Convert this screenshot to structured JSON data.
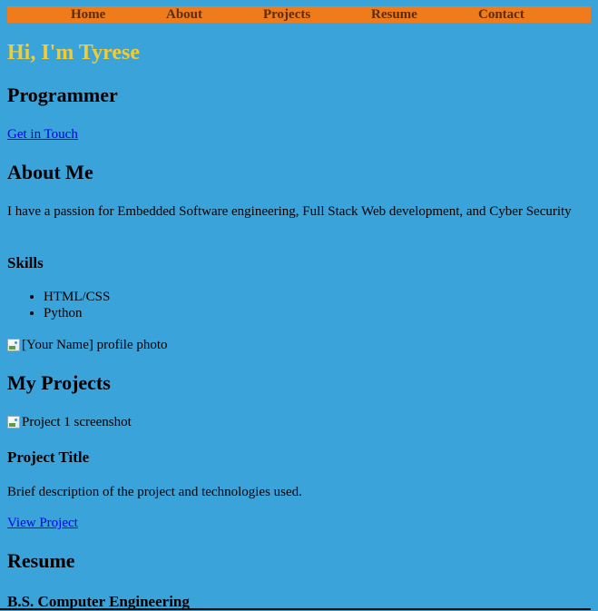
{
  "nav": {
    "items": [
      "Home",
      "About",
      "Projects",
      "Resume",
      "Contact"
    ]
  },
  "hero": {
    "title": "Hi, I'm Tyrese",
    "subtitle": "Programmer",
    "cta": "Get in Touch"
  },
  "about": {
    "title": "About Me",
    "text": "I have a passion for Embedded Software engineering, Full Stack Web development, and Cyber Security",
    "skills_title": "Skills",
    "skills": [
      "HTML/CSS",
      "Python"
    ],
    "photo_alt": "[Your Name] profile photo"
  },
  "projects": {
    "title": "My Projects",
    "screenshot_alt": "Project 1 screenshot",
    "project_title": "Project Title",
    "description": "Brief description of the project and technologies used.",
    "link": "View Project"
  },
  "resume": {
    "title": "Resume",
    "degree": "B.S. Computer Engineering"
  },
  "colors": {
    "page_background": "#3aa3da",
    "nav_background": "#ef7b1a",
    "hero_title": "#f2cc33",
    "link": "#0000ee"
  }
}
